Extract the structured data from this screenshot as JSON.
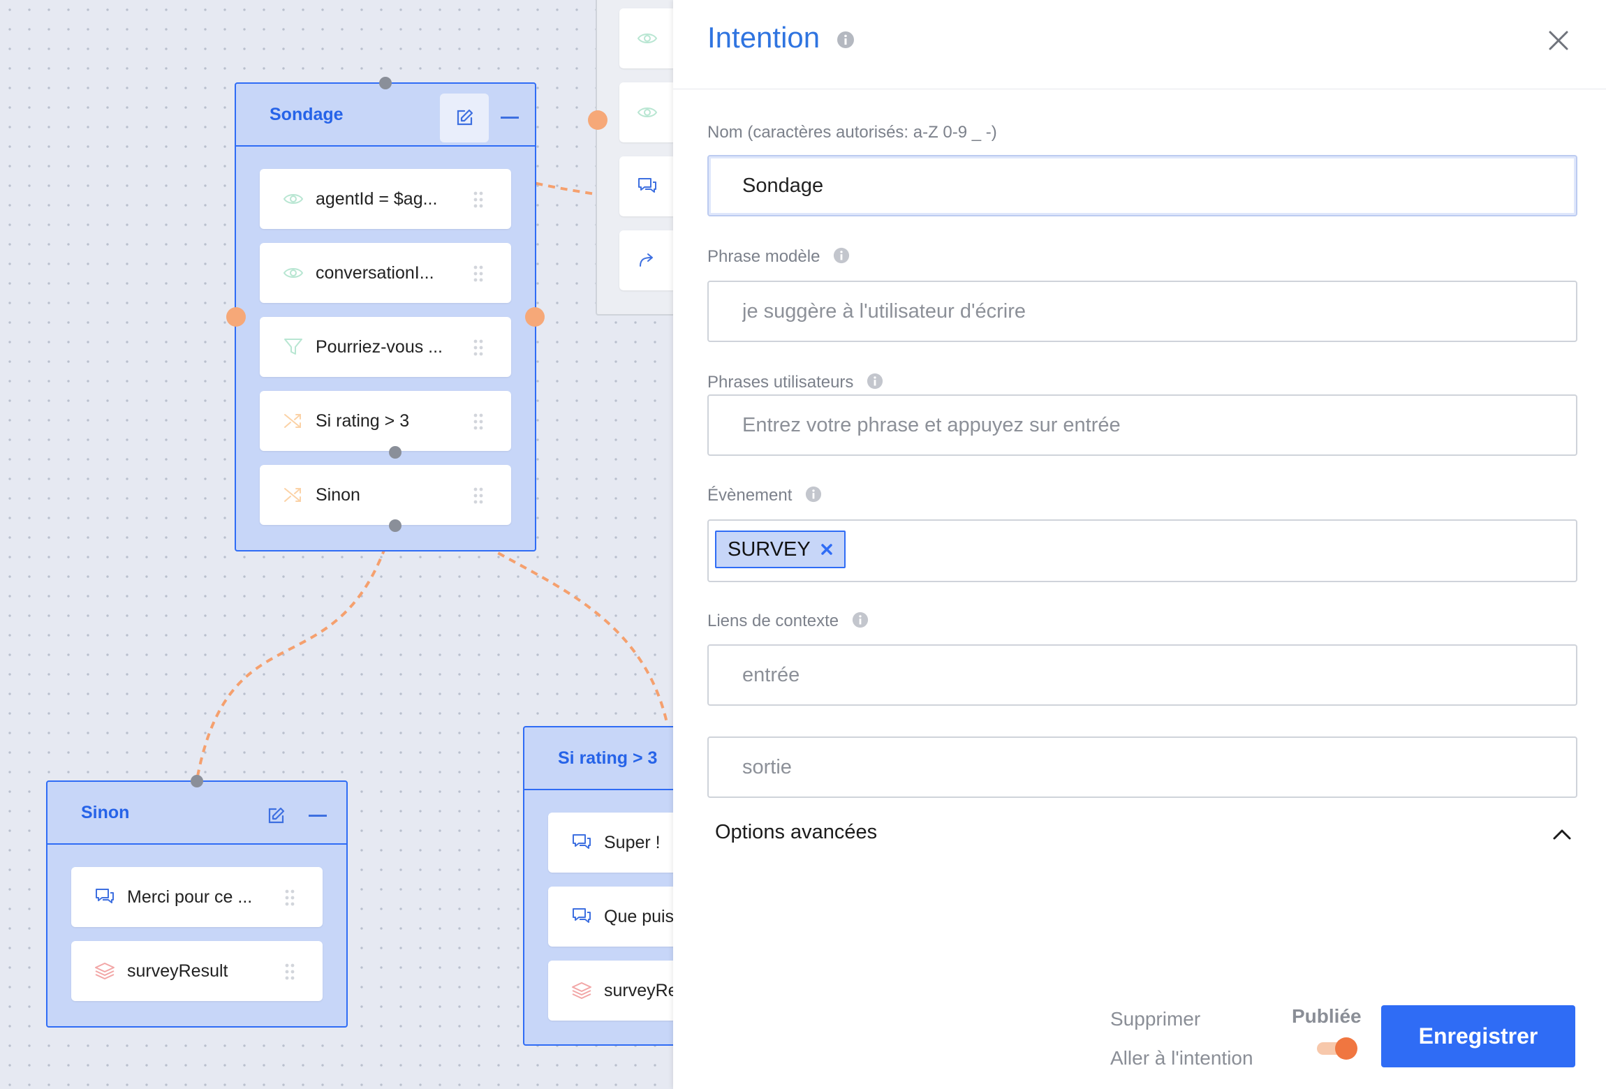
{
  "nodes": {
    "sondage": {
      "title": "Sondage",
      "steps": [
        "agentId = $ag...",
        "conversationI...",
        "Pourriez-vous ...",
        "Si rating > 3",
        "Sinon"
      ]
    },
    "sinon": {
      "title": "Sinon",
      "steps": [
        "Merci pour ce ...",
        "surveyResult"
      ]
    },
    "si_rating": {
      "title": "Si rating > 3",
      "steps": [
        "Super !",
        "Que puis",
        "surveyRe"
      ]
    }
  },
  "panel": {
    "title": "Intention",
    "name_label": "Nom (caractères autorisés: a-Z 0-9 _ -)",
    "name_value": "Sondage",
    "model_label": "Phrase modèle",
    "model_placeholder": "je suggère à l'utilisateur d'écrire",
    "user_label": "Phrases utilisateurs",
    "user_placeholder": "Entrez votre phrase et appuyez sur entrée",
    "event_label": "Évènement",
    "event_tag": "SURVEY",
    "context_label": "Liens de contexte",
    "context_in_placeholder": "entrée",
    "context_out_placeholder": "sortie",
    "advanced": "Options avancées",
    "delete": "Supprimer",
    "goto": "Aller à l'intention",
    "published": "Publiée",
    "published_on": true,
    "save": "Enregistrer"
  },
  "colors": {
    "accent": "#2f6cf5",
    "node_bg": "#c7d6f8",
    "wire": "#f5a06e",
    "toggle_on": "#f07640"
  }
}
